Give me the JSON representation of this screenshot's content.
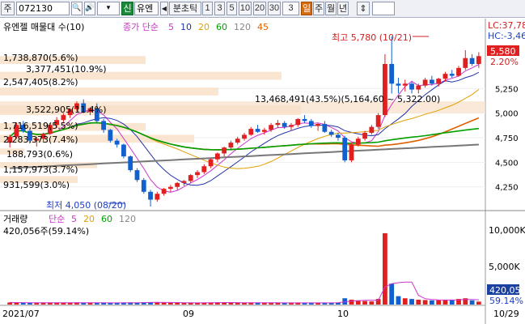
{
  "toolbar": {
    "market": "주",
    "code": "072130",
    "search_btn": "🔍",
    "sound_btn": "🔊",
    "new_badge": "신",
    "stock_name": "유엔",
    "prev_btn": "◀",
    "timeframe_label": "분초틱",
    "intervals": [
      "1",
      "3",
      "5",
      "10",
      "20",
      "30"
    ],
    "period_value": "3",
    "day_btn": "일",
    "week_btn": "주",
    "month_btn": "월",
    "year_btn": "년",
    "updown_btn": "⇕"
  },
  "price_panel": {
    "header": {
      "stock": "유엔젤 매물대 수(10)",
      "ma_label": "종가 단순",
      "ma_periods": [
        {
          "value": "5",
          "color": "#cc33cc"
        },
        {
          "value": "10",
          "color": "#2233aa"
        },
        {
          "value": "20",
          "color": "#e0a000"
        },
        {
          "value": "60",
          "color": "#00a000"
        },
        {
          "value": "120",
          "color": "#888888"
        },
        {
          "value": "45",
          "color": "#e06000"
        }
      ]
    },
    "volume_profile_labels": [
      "1,738,870(5.6%)",
      "3,377,451(10.9%)",
      "2,547,405(8.2%)",
      "3,522,905(11.4%)",
      "1,716,519(5.5%)",
      "2,283,373(7.4%)",
      "188,793(0.6%)",
      "1,157,973(3.7%)",
      "931,599(3.0%)",
      "13,468,491(43.5%)(5,164,60 ~ 5,322.00)"
    ],
    "max_label": "최고 5,780 (10/21)",
    "min_label": "최저 4,050 (08/20)",
    "lc_label": "LC:37,78",
    "hc_label": "HC:-3,46",
    "current_price": "5,580",
    "current_pct": "2.20%",
    "y_ticks": [
      "5,250",
      "5,000",
      "4,750",
      "4,500",
      "4,250"
    ]
  },
  "volume_panel": {
    "header": {
      "title": "거래량",
      "ma_label": "단순",
      "ma_periods": [
        {
          "value": "5",
          "color": "#cc33cc"
        },
        {
          "value": "20",
          "color": "#e0a000"
        },
        {
          "value": "60",
          "color": "#00a000"
        },
        {
          "value": "120",
          "color": "#888888"
        }
      ]
    },
    "current_label": "420,056주(59.14%)",
    "y_ticks": [
      "10,000K",
      "5,000K"
    ],
    "current_tag": "420,05",
    "pct_tag": "59.14%"
  },
  "x_axis": {
    "labels": [
      "2021/07",
      "09",
      "10",
      "10/29"
    ]
  },
  "colors": {
    "up": "#e02020",
    "down": "#1060d0",
    "profile": "#f8e0c8"
  },
  "chart_data": {
    "type": "candlestick",
    "x_labels": [
      "2021/07",
      "09",
      "10",
      "10/29"
    ],
    "candles": [
      [
        4700,
        4780,
        4650,
        4760
      ],
      [
        4760,
        4900,
        4740,
        4880
      ],
      [
        4880,
        4920,
        4800,
        4820
      ],
      [
        4820,
        4840,
        4700,
        4720
      ],
      [
        4720,
        4760,
        4660,
        4740
      ],
      [
        4740,
        4800,
        4700,
        4790
      ],
      [
        4790,
        4900,
        4780,
        4880
      ],
      [
        4880,
        4960,
        4850,
        4930
      ],
      [
        4930,
        5000,
        4900,
        4980
      ],
      [
        4980,
        5050,
        4950,
        5040
      ],
      [
        5040,
        5120,
        5020,
        5100
      ],
      [
        5100,
        5140,
        5000,
        5010
      ],
      [
        5010,
        5060,
        4980,
        5050
      ],
      [
        5050,
        5100,
        4900,
        4920
      ],
      [
        4920,
        4940,
        4800,
        4830
      ],
      [
        4830,
        4840,
        4700,
        4720
      ],
      [
        4720,
        4740,
        4650,
        4680
      ],
      [
        4680,
        4690,
        4540,
        4560
      ],
      [
        4560,
        4570,
        4400,
        4420
      ],
      [
        4420,
        4440,
        4300,
        4320
      ],
      [
        4320,
        4340,
        4180,
        4200
      ],
      [
        4200,
        4220,
        4050,
        4120
      ],
      [
        4120,
        4200,
        4100,
        4180
      ],
      [
        4180,
        4240,
        4160,
        4230
      ],
      [
        4230,
        4270,
        4200,
        4250
      ],
      [
        4250,
        4300,
        4220,
        4290
      ],
      [
        4290,
        4320,
        4260,
        4310
      ],
      [
        4310,
        4380,
        4290,
        4370
      ],
      [
        4370,
        4420,
        4340,
        4400
      ],
      [
        4400,
        4480,
        4380,
        4460
      ],
      [
        4460,
        4540,
        4440,
        4530
      ],
      [
        4530,
        4600,
        4500,
        4590
      ],
      [
        4590,
        4660,
        4560,
        4650
      ],
      [
        4650,
        4720,
        4620,
        4700
      ],
      [
        4700,
        4760,
        4680,
        4740
      ],
      [
        4740,
        4800,
        4720,
        4780
      ],
      [
        4780,
        4860,
        4770,
        4840
      ],
      [
        4840,
        4880,
        4800,
        4810
      ],
      [
        4810,
        4850,
        4780,
        4830
      ],
      [
        4830,
        4900,
        4810,
        4880
      ],
      [
        4880,
        4930,
        4850,
        4900
      ],
      [
        4900,
        4920,
        4840,
        4860
      ],
      [
        4860,
        4900,
        4820,
        4880
      ],
      [
        4880,
        4950,
        4860,
        4940
      ],
      [
        4940,
        4980,
        4900,
        4920
      ],
      [
        4920,
        4940,
        4850,
        4870
      ],
      [
        4870,
        4900,
        4820,
        4890
      ],
      [
        4890,
        4920,
        4800,
        4810
      ],
      [
        4810,
        4830,
        4760,
        4780
      ],
      [
        4780,
        4800,
        4720,
        4750
      ],
      [
        4750,
        4770,
        4500,
        4520
      ],
      [
        4520,
        4700,
        4500,
        4680
      ],
      [
        4680,
        4760,
        4660,
        4740
      ],
      [
        4740,
        4820,
        4720,
        4800
      ],
      [
        4800,
        4880,
        4780,
        4860
      ],
      [
        4860,
        5000,
        4840,
        4980
      ],
      [
        4980,
        5600,
        4960,
        5500
      ],
      [
        5500,
        5780,
        5200,
        5300
      ],
      [
        5300,
        5360,
        5200,
        5280
      ],
      [
        5280,
        5340,
        5220,
        5300
      ],
      [
        5300,
        5320,
        5200,
        5240
      ],
      [
        5240,
        5300,
        5200,
        5280
      ],
      [
        5280,
        5360,
        5260,
        5340
      ],
      [
        5340,
        5380,
        5280,
        5300
      ],
      [
        5300,
        5360,
        5270,
        5350
      ],
      [
        5350,
        5420,
        5320,
        5400
      ],
      [
        5400,
        5440,
        5360,
        5380
      ],
      [
        5380,
        5480,
        5370,
        5460
      ],
      [
        5460,
        5640,
        5440,
        5560
      ],
      [
        5560,
        5600,
        5480,
        5500
      ],
      [
        5500,
        5620,
        5460,
        5580
      ]
    ],
    "volume": [
      300,
      280,
      260,
      240,
      250,
      270,
      300,
      260,
      250,
      280,
      300,
      260,
      240,
      230,
      250,
      260,
      240,
      270,
      300,
      280,
      320,
      350,
      300,
      280,
      260,
      250,
      240,
      230,
      260,
      280,
      300,
      320,
      280,
      260,
      250,
      240,
      260,
      280,
      250,
      240,
      230,
      240,
      250,
      260,
      240,
      230,
      220,
      250,
      270,
      300,
      900,
      700,
      600,
      500,
      450,
      800,
      10200,
      3000,
      1200,
      900,
      800,
      700,
      650,
      600,
      620,
      650,
      700,
      800,
      900,
      600,
      420
    ],
    "ylim": [
      4050,
      5780
    ],
    "volume_ylim": [
      0,
      11000
    ]
  }
}
